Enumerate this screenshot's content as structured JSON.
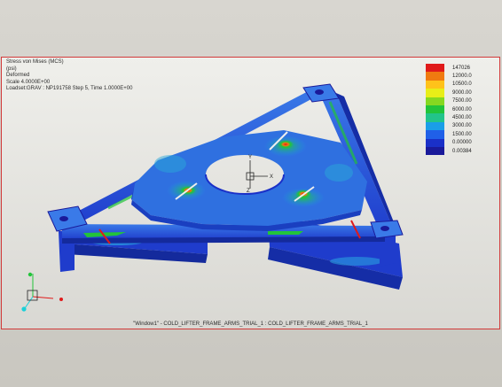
{
  "info": {
    "line1": "Stress von Mises (MCS)",
    "line2": "(psi)",
    "line3": "Deformed",
    "line4": "Scale  4.0000E+00",
    "line5": "Loadset:GRAV :  NP191758 Step 5, Time  1.0000E+00"
  },
  "legend": [
    {
      "label": "147026",
      "color": "#e01a1a"
    },
    {
      "label": "12000.0",
      "color": "#f07a10"
    },
    {
      "label": "10500.0",
      "color": "#ffc21a"
    },
    {
      "label": "9000.00",
      "color": "#e8ee18"
    },
    {
      "label": "7500.00",
      "color": "#86d820"
    },
    {
      "label": "6000.00",
      "color": "#22c43a"
    },
    {
      "label": "4500.00",
      "color": "#22c48a"
    },
    {
      "label": "3000.00",
      "color": "#1a9ee8"
    },
    {
      "label": "1500.00",
      "color": "#2060e8"
    },
    {
      "label": "0.00000",
      "color": "#1a30c8"
    },
    {
      "label": "0.00384",
      "color": "#1a1a9a"
    }
  ],
  "axes": {
    "x": "X",
    "y": "Y",
    "z": "Z"
  },
  "caption": "\"Window1\" - COLD_LIFTER_FRAME_ARMS_TRIAL_1 : COLD_LIFTER_FRAME_ARMS_TRIAL_1"
}
